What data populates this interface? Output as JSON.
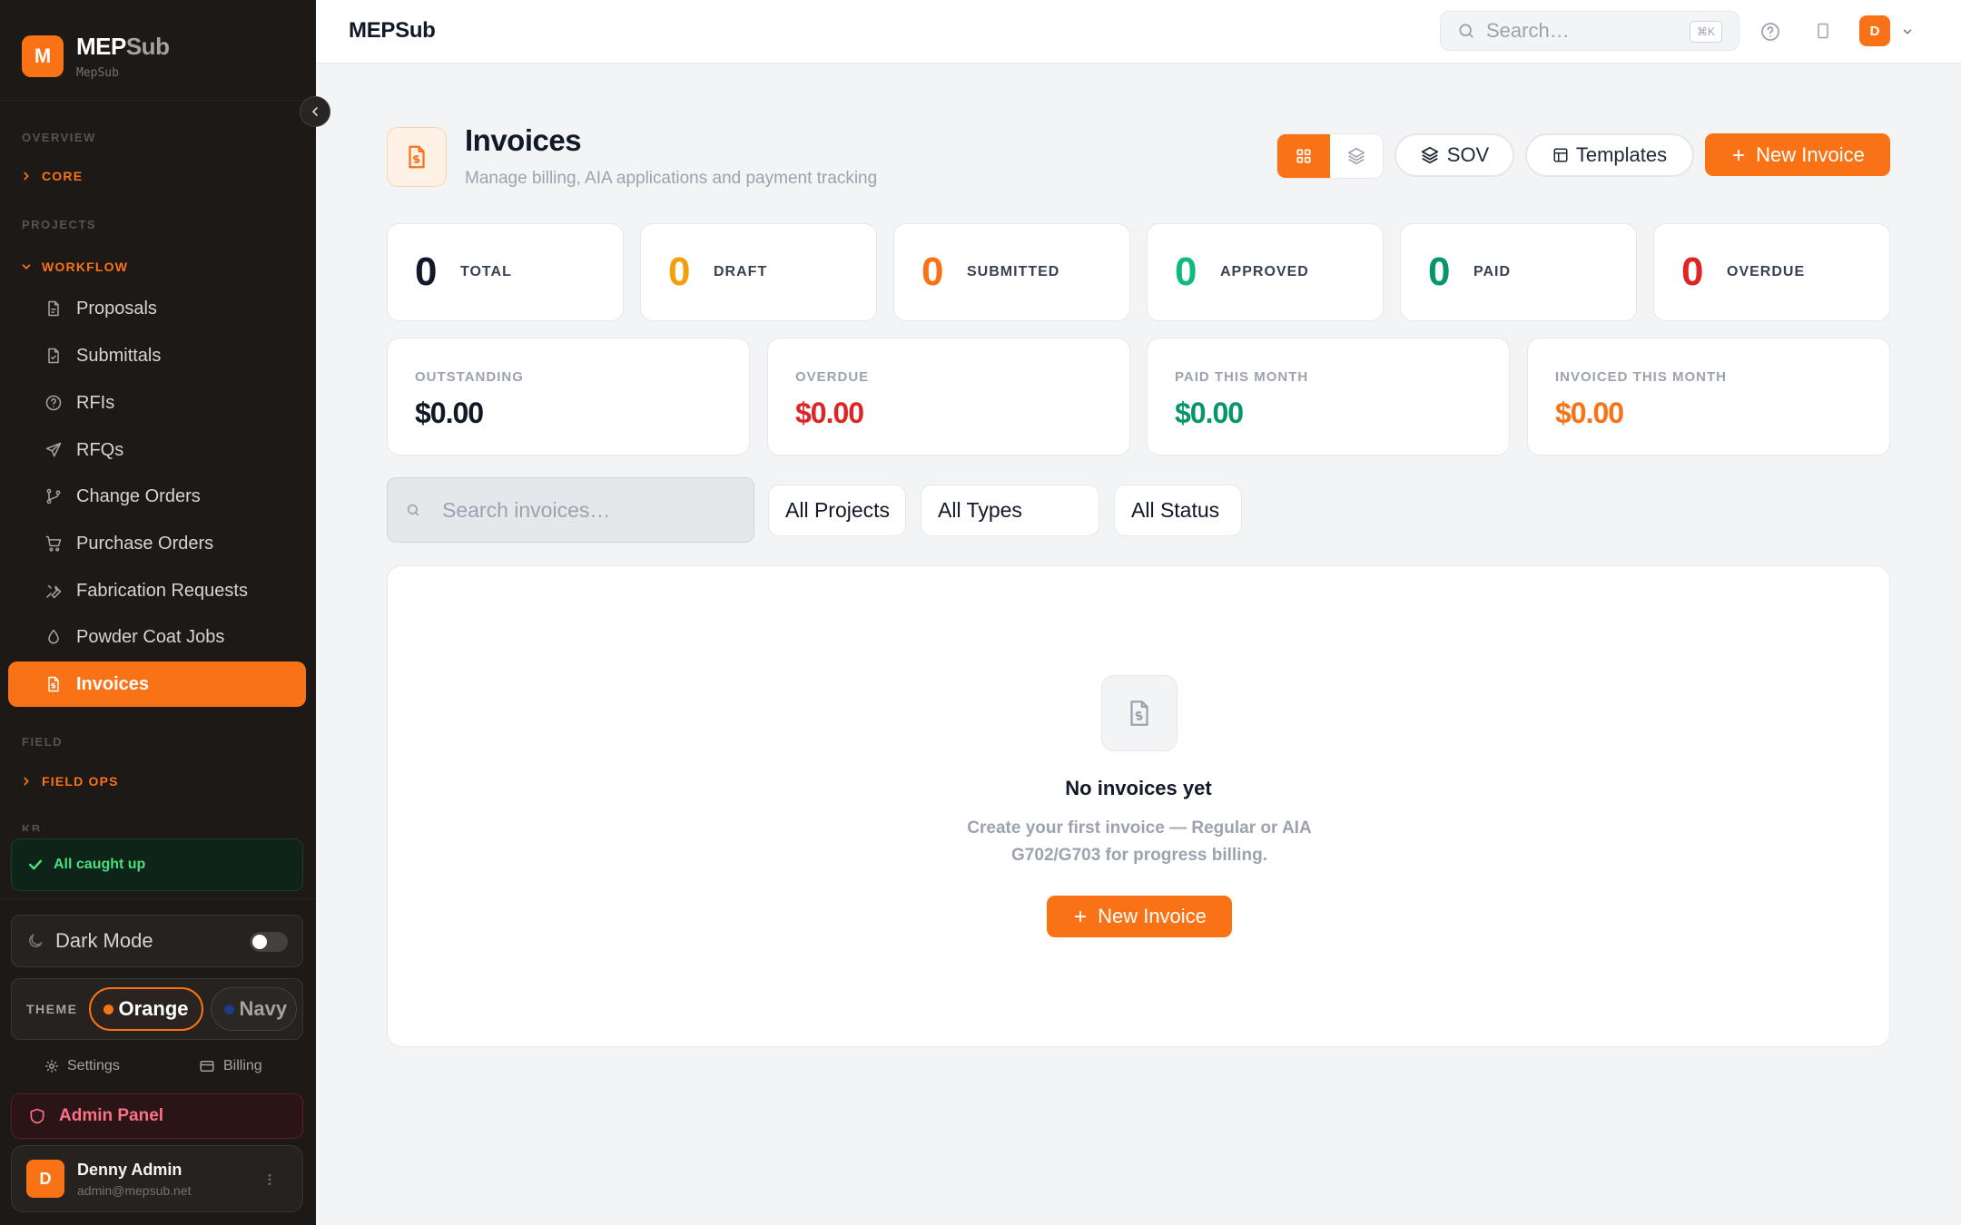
{
  "brand": {
    "logo_letter": "M",
    "name_main": "MEP",
    "name_sub": "Sub",
    "tagline": "MepSub"
  },
  "sidebar": {
    "sections": {
      "overview": "OVERVIEW",
      "projects": "PROJECTS",
      "field": "FIELD",
      "kb": "KB"
    },
    "groups": {
      "core": "CORE",
      "workflow": "WORKFLOW",
      "field_ops": "FIELD OPS"
    },
    "items": [
      {
        "label": "Proposals",
        "icon": "file-icon"
      },
      {
        "label": "Submittals",
        "icon": "file-check-icon"
      },
      {
        "label": "RFIs",
        "icon": "help-circle-icon"
      },
      {
        "label": "RFQs",
        "icon": "send-icon"
      },
      {
        "label": "Change Orders",
        "icon": "git-branch-icon"
      },
      {
        "label": "Purchase Orders",
        "icon": "cart-icon"
      },
      {
        "label": "Fabrication Requests",
        "icon": "wrench-icon"
      },
      {
        "label": "Powder Coat Jobs",
        "icon": "droplet-icon"
      },
      {
        "label": "Invoices",
        "icon": "invoice-icon",
        "active": true
      }
    ],
    "caught_up": "All caught up",
    "dark_mode_label": "Dark Mode",
    "theme_label": "THEME",
    "theme_options": [
      "Orange",
      "Navy"
    ],
    "settings_label": "Settings",
    "billing_label": "Billing",
    "admin_panel_label": "Admin Panel",
    "user": {
      "initial": "D",
      "name": "Denny Admin",
      "email": "admin@mepsub.net"
    }
  },
  "topbar": {
    "title": "MEPSub",
    "search_placeholder": "Search…",
    "search_shortcut": "⌘K",
    "avatar_initial": "D"
  },
  "page": {
    "title": "Invoices",
    "subtitle": "Manage billing, AIA applications and payment tracking",
    "sov_label": "SOV",
    "templates_label": "Templates",
    "new_invoice_label": "New Invoice"
  },
  "stats": [
    {
      "value": "0",
      "label": "TOTAL",
      "color": "#111827"
    },
    {
      "value": "0",
      "label": "DRAFT",
      "color": "#f59e0b"
    },
    {
      "value": "0",
      "label": "SUBMITTED",
      "color": "#f97316"
    },
    {
      "value": "0",
      "label": "APPROVED",
      "color": "#10b981"
    },
    {
      "value": "0",
      "label": "PAID",
      "color": "#059669"
    },
    {
      "value": "0",
      "label": "OVERDUE",
      "color": "#dc2626"
    }
  ],
  "money": [
    {
      "label": "OUTSTANDING",
      "value": "$0.00",
      "color": "#111827"
    },
    {
      "label": "OVERDUE",
      "value": "$0.00",
      "color": "#dc2626"
    },
    {
      "label": "PAID THIS MONTH",
      "value": "$0.00",
      "color": "#059669"
    },
    {
      "label": "INVOICED THIS MONTH",
      "value": "$0.00",
      "color": "#f97316"
    }
  ],
  "filters": {
    "search_placeholder": "Search invoices…",
    "projects": "All Projects",
    "types": "All Types",
    "status": "All Status"
  },
  "empty": {
    "title": "No invoices yet",
    "description": "Create your first invoice — Regular or AIA G702/G703 for progress billing.",
    "button": "New Invoice"
  },
  "colors": {
    "accent": "#f97316",
    "sidebar_bg": "#1c1917"
  }
}
